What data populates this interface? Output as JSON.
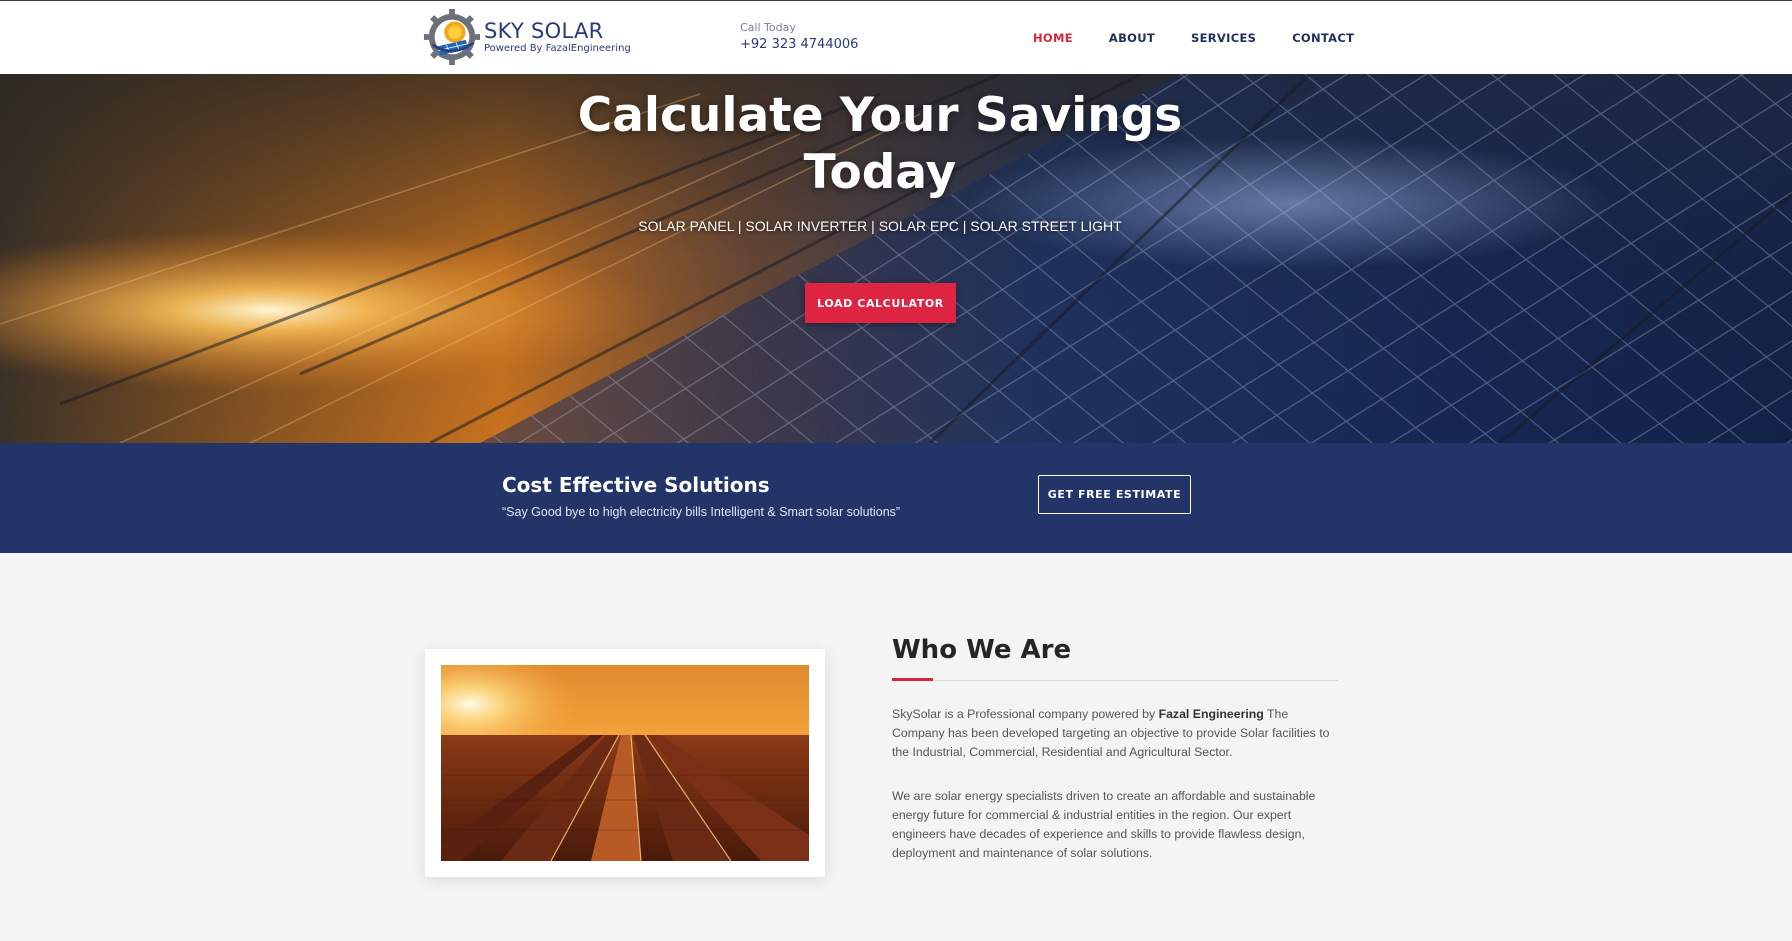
{
  "header": {
    "logo_title": "SKY SOLAR",
    "logo_subtitle": "Powered By FazalEngineering",
    "call_label": "Call Today",
    "call_phone": "+92 323 4744006"
  },
  "nav": {
    "items": [
      {
        "label": "HOME",
        "active": true
      },
      {
        "label": "ABOUT",
        "active": false
      },
      {
        "label": "SERVICES",
        "active": false
      },
      {
        "label": "CONTACT",
        "active": false
      }
    ]
  },
  "hero": {
    "title_line1": "Calculate Your Savings",
    "title_line2": "Today",
    "subtitle": "SOLAR PANEL | SOLAR INVERTER | SOLAR EPC | SOLAR STREET LIGHT",
    "button_label": "LOAD CALCULATOR"
  },
  "band": {
    "title": "Cost Effective Solutions",
    "text": "“Say Good bye to high electricity bills Intelligent & Smart solar solutions”",
    "button_label": "GET FREE ESTIMATE"
  },
  "about": {
    "heading": "Who We Are",
    "p1_before": "SkySolar is a Professional company powered by ",
    "p1_bold": "Fazal Engineering",
    "p1_after": " The Company has been developed targeting an objective to provide Solar facilities to the Industrial, Commercial, Residential and Agricultural Sector.",
    "p2": "We are solar energy specialists driven to create an affordable and sustainable energy future for commercial & industrial entities in the region. Our expert engineers have decades of experience and skills to provide flawless design, deployment and maintenance of solar solutions."
  },
  "colors": {
    "accent_red": "#dd2440",
    "navy": "#223468",
    "brand_blue": "#2a3a7c"
  },
  "icons": [
    "sky-solar-logo",
    "hero-solar-panel-image",
    "solar-field-sunset-image"
  ]
}
